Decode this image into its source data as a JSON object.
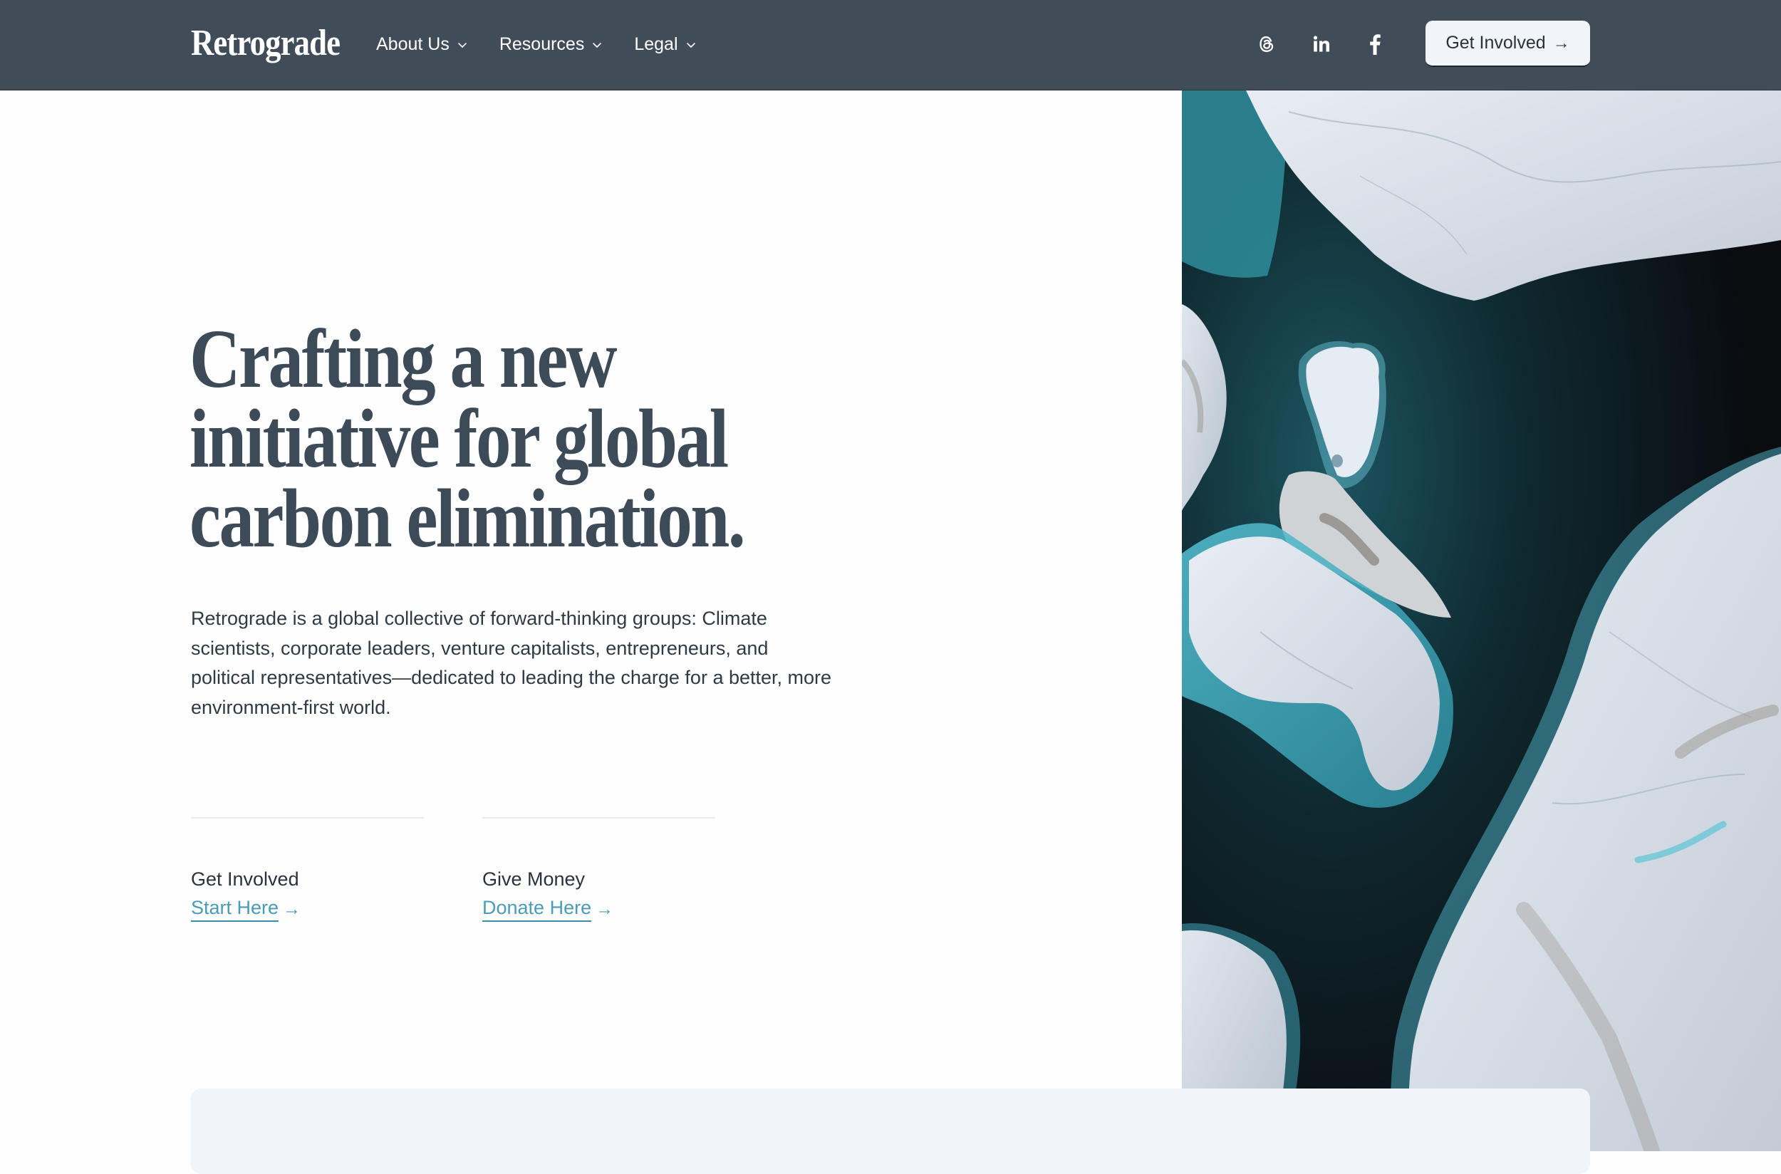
{
  "nav": {
    "logo": "Retrograde",
    "menu": [
      {
        "label": "About Us",
        "icon": "chevron-down-icon"
      },
      {
        "label": "Resources",
        "icon": "chevron-down-icon"
      },
      {
        "label": "Legal",
        "icon": "chevron-down-icon"
      }
    ],
    "social": [
      {
        "name": "threads",
        "icon": "threads-icon"
      },
      {
        "name": "linkedin",
        "icon": "linkedin-icon"
      },
      {
        "name": "facebook",
        "icon": "facebook-icon"
      }
    ],
    "cta": {
      "label": "Get Involved",
      "icon": "arrow-right-icon",
      "arrow": "→"
    }
  },
  "hero": {
    "headline_lines": [
      "Crafting a new",
      "initiative for global",
      "carbon elimination."
    ],
    "lead": "Retrograde is a global collective of forward-thinking groups: Climate scientists, corporate leaders, venture capitalists, entrepreneurs, and political representatives—dedicated to leading the charge for a better, more environment-first world.",
    "actions": [
      {
        "title": "Get Involved",
        "link_label": "Start Here",
        "arrow": "→"
      },
      {
        "title": "Give Money",
        "link_label": "Donate Here",
        "arrow": "→"
      }
    ],
    "image": {
      "description": "Aerial view of icebergs in dark teal water"
    }
  },
  "colors": {
    "nav_bg": "#414c59",
    "headline": "#3d4a57",
    "body_text": "#303a44",
    "link": "#4c9bb8",
    "card_bg": "#f1f4f8"
  }
}
